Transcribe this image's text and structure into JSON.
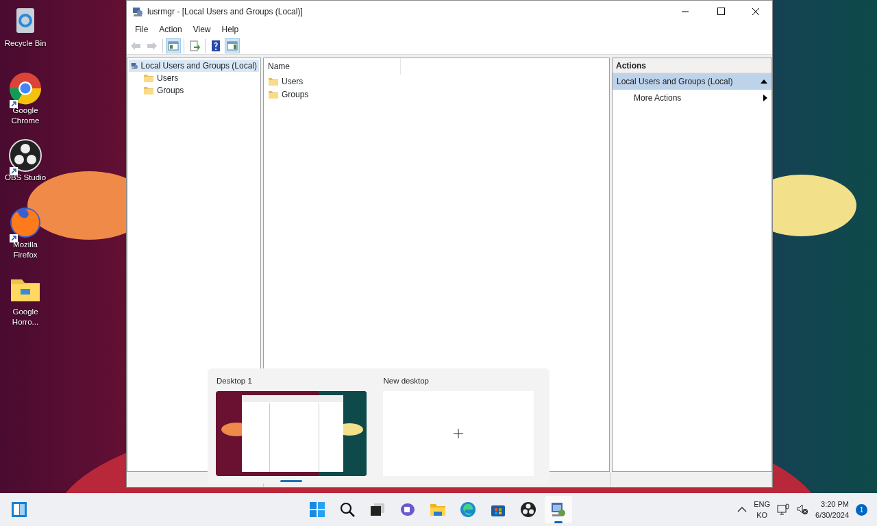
{
  "desktop_icons": [
    {
      "label": "Recycle Bin",
      "kind": "recycle",
      "shortcut": false
    },
    {
      "label": "Google Chrome",
      "kind": "chrome",
      "shortcut": true
    },
    {
      "label": "OBS Studio",
      "kind": "obs",
      "shortcut": true
    },
    {
      "label": "Mozilla Firefox",
      "kind": "firefox",
      "shortcut": true
    },
    {
      "label": "Google Horro...",
      "kind": "folder",
      "shortcut": false
    }
  ],
  "window": {
    "title": "lusrmgr - [Local Users and Groups (Local)]",
    "menu": [
      "File",
      "Action",
      "View",
      "Help"
    ],
    "toolbar": [
      {
        "kind": "back",
        "disabled": true
      },
      {
        "kind": "forward",
        "disabled": true
      },
      {
        "kind": "sep"
      },
      {
        "kind": "console-tree",
        "selected": true
      },
      {
        "kind": "sep"
      },
      {
        "kind": "export",
        "selected": false
      },
      {
        "kind": "sep"
      },
      {
        "kind": "help",
        "selected": false
      },
      {
        "kind": "action-pane",
        "selected": true
      }
    ],
    "tree": [
      {
        "label": "Local Users and Groups (Local)",
        "kind": "root",
        "selected": true,
        "children": [
          {
            "label": "Users",
            "selected": false
          },
          {
            "label": "Groups",
            "selected": false
          }
        ]
      }
    ],
    "list": {
      "columns": [
        "Name"
      ],
      "items": [
        "Users",
        "Groups"
      ]
    },
    "actions": {
      "title": "Actions",
      "sections": [
        {
          "label": "Local Users and Groups (Local)",
          "expanded": true,
          "items": [
            "More Actions"
          ]
        }
      ]
    }
  },
  "task_view": {
    "desktops": [
      {
        "label": "Desktop 1",
        "kind": "preview",
        "selected": true
      },
      {
        "label": "New desktop",
        "kind": "new",
        "selected": false
      }
    ]
  },
  "taskbar": {
    "apps": [
      {
        "kind": "start",
        "running": false
      },
      {
        "kind": "search",
        "running": false
      },
      {
        "kind": "taskview",
        "running": false
      },
      {
        "kind": "chat",
        "running": false
      },
      {
        "kind": "explorer",
        "running": false
      },
      {
        "kind": "edge",
        "running": false
      },
      {
        "kind": "store",
        "running": false
      },
      {
        "kind": "obs",
        "running": false
      },
      {
        "kind": "mmc",
        "running": true
      }
    ],
    "language": [
      "ENG",
      "KO"
    ],
    "time": "3:20 PM",
    "date": "6/30/2024",
    "notifications": "1"
  }
}
